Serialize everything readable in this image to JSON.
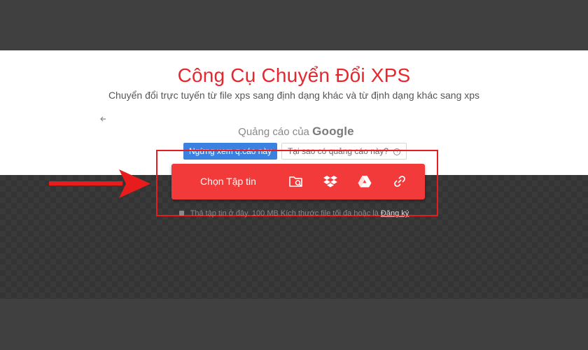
{
  "header": {
    "title": "Công Cụ Chuyển Đổi XPS",
    "subtitle": "Chuyển đổi trực tuyến từ file xps sang định dạng khác và từ định dạng khác sang xps"
  },
  "ad": {
    "back_icon": "arrow-left-icon",
    "label_prefix": "Quảng cáo của",
    "label_brand": "Google",
    "stop_button": "Ngừng xem q.cáo này",
    "why_button": "Tại sao có quảng cáo này?",
    "info_icon": "i"
  },
  "upload": {
    "choose_label": "Chọn Tập tin",
    "sources": [
      "folder-search-icon",
      "dropbox-icon",
      "google-drive-icon",
      "link-icon"
    ],
    "note_prefix": "Thả tập tin ở đây. 100 MB Kích thước file tối đa hoặc là",
    "note_link": "Đăng ký"
  },
  "colors": {
    "title": "#e8262d",
    "upload_bar": "#f23a3a",
    "annotation": "#e81c1c",
    "ad_button": "#3b82e0"
  }
}
